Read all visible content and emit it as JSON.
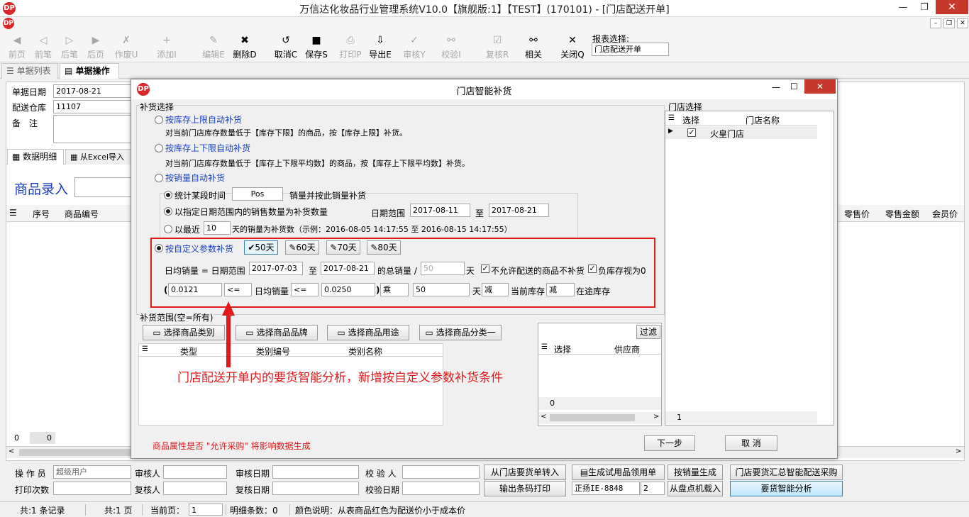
{
  "window": {
    "title": "万信达化妆品行业管理系统V10.0【旗舰版:1】【TEST】(170101) - [门店配送开单]",
    "minimize": "—",
    "restore": "❒",
    "close": "✕",
    "logo": "DP"
  },
  "toolbar": {
    "items": [
      {
        "label": "前页",
        "icon": "◀",
        "disabled": true
      },
      {
        "label": "前笔",
        "icon": "◁",
        "disabled": true
      },
      {
        "label": "后笔",
        "icon": "▷",
        "disabled": true
      },
      {
        "label": "后页",
        "icon": "▶",
        "disabled": true
      },
      {
        "label": "作废U",
        "icon": "✗",
        "disabled": true
      },
      {
        "label": "添加I",
        "icon": "+",
        "disabled": true
      },
      {
        "label": "编辑E",
        "icon": "✎",
        "disabled": true
      },
      {
        "label": "删除D",
        "icon": "✖",
        "disabled": false
      },
      {
        "label": "取消C",
        "icon": "↺",
        "disabled": false
      },
      {
        "label": "保存S",
        "icon": "■",
        "disabled": false
      },
      {
        "label": "打印P",
        "icon": "⎙",
        "disabled": true
      },
      {
        "label": "导出E",
        "icon": "⇩",
        "disabled": false
      },
      {
        "label": "审核Y",
        "icon": "✓",
        "disabled": true
      },
      {
        "label": "校验I",
        "icon": "⚯",
        "disabled": true
      },
      {
        "label": "复核R",
        "icon": "☑",
        "disabled": true
      },
      {
        "label": "相关",
        "icon": "⚯",
        "disabled": false
      },
      {
        "label": "关闭Q",
        "icon": "✕",
        "disabled": false
      }
    ],
    "report_label": "报表选择:",
    "report_value": "门店配送开单"
  },
  "tabs": {
    "list": "单据列表",
    "op": "单据操作"
  },
  "form": {
    "date_label": "单据日期",
    "date_value": "2017-08-21",
    "warehouse_label": "配送仓库",
    "warehouse_value": "11107",
    "remark_label": "备　注"
  },
  "subtabs": {
    "detail": "数据明细",
    "excel": "从Excel导入"
  },
  "entry": {
    "title": "商品录入"
  },
  "grid": {
    "cols": [
      "序号",
      "商品编号"
    ],
    "right_cols": [
      "零售价",
      "零售金额",
      "会员价"
    ],
    "footer": [
      "0",
      "0"
    ]
  },
  "bottom": {
    "operator_label": "操 作 员",
    "operator_value": "超级用户",
    "reviewer_label": "审核人",
    "review_date_label": "审核日期",
    "checker_label": "校 验 人",
    "print_label": "打印次数",
    "rechecker_label": "复核人",
    "recheck_date_label": "复核日期",
    "check_date_label": "校验日期",
    "btn1": "从门店要货单转入",
    "btn2": "输出条码打印",
    "btn3": "生成试用品领用单",
    "btn4": "按销量生成",
    "btn5": "门店要货汇总智能配送采购",
    "btn6": "要货智能分析",
    "printer": "正扬IE-8848",
    "copies": "2",
    "btn7": "从盘点机载入"
  },
  "status": {
    "records": "共:1 条记录",
    "pages": "共:1 页",
    "cur_label": "当前页：",
    "cur_value": "1",
    "detail_count": "明细条数：0",
    "color_note": "颜色说明：从表商品红色为配送价小于成本价"
  },
  "dialog": {
    "title": "门店智能补货",
    "section": "补货选择",
    "opt1_title": "按库存上限自动补货",
    "opt1_desc": "对当前门店库存数量低于【库存下限】的商品，按【库存上限】补货。",
    "opt2_title": "按库存上下限自动补货",
    "opt2_desc": "对当前门店库存数量低于【库存上下限平均数】的商品，按【库存上下限平均数】补货。",
    "opt3_title": "按销量自动补货",
    "sub1_label": "统计某段时间",
    "sub1_value": "Pos",
    "sub1_suffix": "销量并按此销量补货",
    "sub2_label": "以指定日期范围内的销售数量为补货数量",
    "range_label": "日期范围",
    "range_from": "2017-08-11",
    "range_to_label": "至",
    "range_to": "2017-08-21",
    "sub3_label": "以最近",
    "sub3_value": "10",
    "sub3_suffix": "天的销量为补货数（示例：2016-08-05 14:17:55 至 2016-08-15 14:17:55）",
    "opt4_title": "按自定义参数补货",
    "days": [
      "50天",
      "60天",
      "70天",
      "80天"
    ],
    "avg_label": "日均销量 = 日期范围",
    "avg_from": "2017-07-03",
    "avg_to_label": "至",
    "avg_to": "2017-08-21",
    "avg_total": "的总销量 /",
    "avg_days": "50",
    "avg_unit": "天",
    "chk1": "不允许配送的商品不补货",
    "chk2": "负库存视为0",
    "f_paren_open": "(",
    "f_min": "0.0121",
    "f_op1": "<=",
    "f_mid": "日均销量",
    "f_op2": "<=",
    "f_max": "0.0250",
    "f_paren_close": ")",
    "f_mul": "乘",
    "f_days": "50",
    "f_day_unit": "天",
    "f_sub1": "减",
    "f_stock": "当前库存",
    "f_sub2": "减",
    "f_transit": "在途库存",
    "range_section": "补货范围(空=所有)",
    "cat_btns": [
      "选择商品类别",
      "选择商品品牌",
      "选择商品用途",
      "选择商品分类一"
    ],
    "cat_cols": [
      "类型",
      "类别编号",
      "类别名称"
    ],
    "filter_btn": "过滤",
    "sup_cols": [
      "选择",
      "供应商"
    ],
    "sup_count": "0",
    "store_section": "门店选择",
    "store_cols": [
      "选择",
      "门店名称"
    ],
    "store_row": "火皇门店",
    "store_count": "1",
    "footnote": "商品属性是否 \"允许采购\" 将影响数据生成",
    "next": "下一步",
    "cancel": "取 消"
  },
  "annotation": {
    "text": "门店配送开单内的要货智能分析，新增按自定义参数补货条件"
  }
}
